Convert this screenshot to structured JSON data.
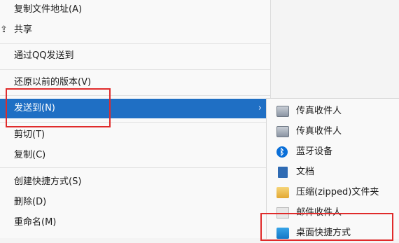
{
  "menu": {
    "items": [
      {
        "label": "复制文件地址(A)"
      },
      {
        "label": "共享"
      },
      {
        "label": "通过QQ发送到"
      },
      {
        "label": "还原以前的版本(V)"
      },
      {
        "label": "发送到(N)"
      },
      {
        "label": "剪切(T)"
      },
      {
        "label": "复制(C)"
      },
      {
        "label": "创建快捷方式(S)"
      },
      {
        "label": "删除(D)"
      },
      {
        "label": "重命名(M)"
      }
    ],
    "chevron": "›"
  },
  "submenu": {
    "items": [
      {
        "label": "传真收件人",
        "icon": "fax-icon"
      },
      {
        "label": "传真收件人",
        "icon": "fax-icon"
      },
      {
        "label": "蓝牙设备",
        "icon": "bluetooth-icon"
      },
      {
        "label": "文档",
        "icon": "document-icon"
      },
      {
        "label": "压缩(zipped)文件夹",
        "icon": "zip-folder-icon"
      },
      {
        "label": "邮件收件人",
        "icon": "mail-icon"
      },
      {
        "label": "桌面快捷方式",
        "icon": "desktop-shortcut-icon"
      }
    ]
  },
  "colors": {
    "selected": "#1f6fc4",
    "highlight_box": "#e02b2b"
  }
}
